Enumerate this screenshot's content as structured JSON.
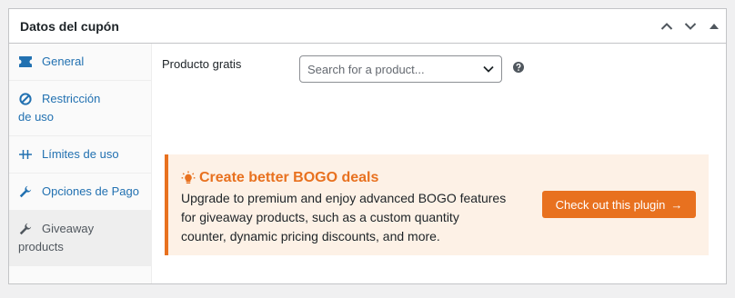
{
  "panel": {
    "title": "Datos del cupón"
  },
  "tabs": [
    {
      "label": "General",
      "icon": "ticket-icon"
    },
    {
      "label_line1": "Restricción",
      "label_line2": "de uso",
      "icon": "prohibited-icon"
    },
    {
      "label": "Límites de uso",
      "icon": "limits-icon"
    },
    {
      "label": "Opciones de Pago",
      "icon": "wrench-icon"
    },
    {
      "label_line1": "Giveaway",
      "label_line2": "products",
      "icon": "wrench-icon",
      "active": true
    }
  ],
  "field": {
    "label": "Producto gratis",
    "placeholder": "Search for a product..."
  },
  "promo": {
    "title": "Create better BOGO deals",
    "desc_line1": "Upgrade to premium and enjoy advanced BOGO features",
    "desc_line2": "for giveaway products, such as a custom quantity",
    "desc_line3": "counter, dynamic pricing discounts, and more.",
    "button": "Check out this plugin",
    "button_arrow": "→"
  },
  "colors": {
    "link": "#2271b1",
    "accent": "#e8711f",
    "promo_bg": "#fdf1e6"
  }
}
